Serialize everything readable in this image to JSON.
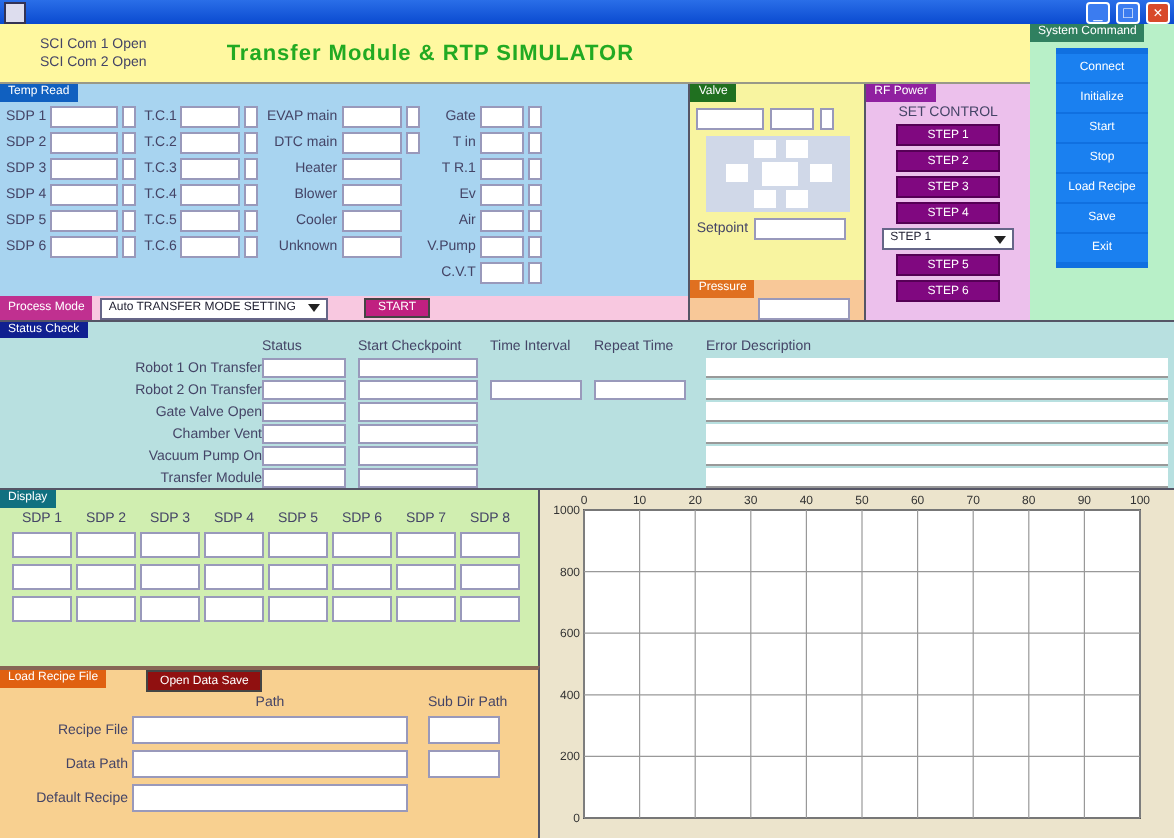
{
  "window": {
    "title_buttons": [
      "_",
      "□",
      "×"
    ]
  },
  "header": {
    "ports": [
      "SCI Com 1 Open",
      "SCI Com 2 Open"
    ],
    "title": "Transfer Module & RTP  SIMULATOR"
  },
  "temp_read": {
    "title": "Temp Read",
    "groups": [
      {
        "items": [
          {
            "label": "SDP 1",
            "kind": "field_box"
          },
          {
            "label": "SDP 2",
            "kind": "field_box"
          },
          {
            "label": "SDP 3",
            "kind": "field_box"
          },
          {
            "label": "SDP 4",
            "kind": "field_box"
          },
          {
            "label": "SDP 5",
            "kind": "field_box"
          },
          {
            "label": "SDP 6",
            "kind": "field_box"
          }
        ]
      },
      {
        "items": [
          {
            "label": "T.C.1",
            "kind": "field_box"
          },
          {
            "label": "T.C.2",
            "kind": "field_box"
          },
          {
            "label": "T.C.3",
            "kind": "field_box"
          },
          {
            "label": "T.C.4",
            "kind": "field_box"
          },
          {
            "label": "T.C.5",
            "kind": "field_box"
          },
          {
            "label": "T.C.6",
            "kind": "field_box"
          }
        ]
      },
      {
        "items": [
          {
            "label": "EVAP main",
            "kind": "field_box"
          },
          {
            "label": "DTC main",
            "kind": "field_box"
          },
          {
            "label": "Heater",
            "kind": "field"
          },
          {
            "label": "Blower",
            "kind": "field"
          },
          {
            "label": "Cooler",
            "kind": "field"
          },
          {
            "label": "Unknown",
            "kind": "field"
          }
        ]
      },
      {
        "items": [
          {
            "label": "Gate",
            "kind": "field_box"
          },
          {
            "label": "T in",
            "kind": "field_box"
          },
          {
            "label": "T R.1",
            "kind": "field_box"
          },
          {
            "label": "Ev",
            "kind": "field_box"
          },
          {
            "label": "Air",
            "kind": "field_box"
          },
          {
            "label": "V.Pump",
            "kind": "field_box"
          },
          {
            "label": "C.V.T",
            "kind": "field_box"
          }
        ]
      }
    ]
  },
  "mode_bar": {
    "label": "Process Mode",
    "dropdown": "Auto TRANSFER MODE SETTING",
    "button": "START"
  },
  "valve": {
    "title": "Valve",
    "label": "Setpoint"
  },
  "pressure": {
    "title": "Pressure"
  },
  "rf_power": {
    "title": "RF Power",
    "subtitle": "SET CONTROL",
    "steps": [
      "STEP 1",
      "STEP 2",
      "STEP 3",
      "STEP 4"
    ],
    "dropdown": "STEP 1",
    "more_steps": [
      "STEP 5",
      "STEP 6"
    ]
  },
  "command": {
    "title": "System Command",
    "buttons": [
      "Connect",
      "Initialize",
      "Start",
      "Stop",
      "Load Recipe",
      "Save",
      "Exit"
    ]
  },
  "status": {
    "title": "Status Check",
    "columns": [
      "Status",
      "Start Checkpoint",
      "Time Interval",
      "Repeat Time",
      "Error Description"
    ],
    "rows": [
      "Robot 1 On Transfer",
      "Robot 2 On Transfer",
      "Gate Valve Open",
      "Chamber Vent",
      "Vacuum Pump On",
      "Transfer Module"
    ]
  },
  "display": {
    "title": "Display",
    "columns": [
      "SDP 1",
      "SDP 2",
      "SDP 3",
      "SDP 4",
      "SDP 5",
      "SDP 6",
      "SDP 7",
      "SDP 8"
    ]
  },
  "recipe": {
    "title": "Load Recipe File",
    "button": "Open Data Save",
    "columns": [
      "Path",
      "Sub Dir Path"
    ],
    "rows": [
      "Recipe File",
      "Data Path",
      "Default Recipe"
    ]
  },
  "chart": {
    "chart_data": {
      "type": "line",
      "grid": true,
      "xlim": [
        0,
        100
      ],
      "ylim": [
        0,
        1000
      ],
      "xticks": [
        0,
        10,
        20,
        30,
        40,
        50,
        60,
        70,
        80,
        90,
        100
      ],
      "yticks": [
        0,
        200,
        400,
        600,
        800,
        1000
      ]
    }
  }
}
